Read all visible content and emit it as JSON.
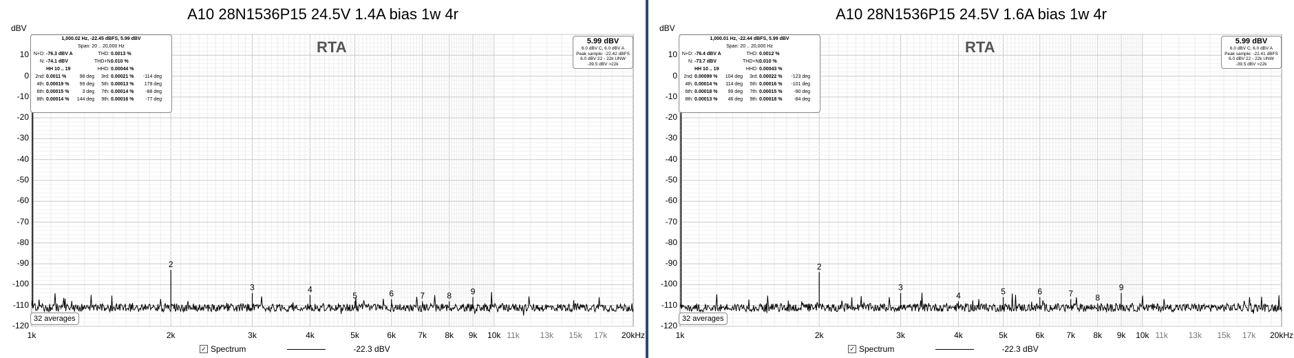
{
  "chart_data": [
    {
      "type": "line",
      "title": "A10 28N1536P15 24.5V 1.4A bias 1w 4r",
      "ylabel": "dBV",
      "xlabel": "",
      "x_scale": "log",
      "xlim": [
        1000,
        20000
      ],
      "ylim": [
        -120,
        20
      ],
      "y_ticks": [
        "10",
        "0",
        "-10",
        "-20",
        "-30",
        "-40",
        "-50",
        "-60",
        "-70",
        "-80",
        "-90",
        "-100",
        "-110",
        "-120"
      ],
      "x_ticks": [
        {
          "v": 1000,
          "label": "1k",
          "dim": false
        },
        {
          "v": 2000,
          "label": "2k",
          "dim": false
        },
        {
          "v": 3000,
          "label": "3k",
          "dim": false
        },
        {
          "v": 4000,
          "label": "4k",
          "dim": false
        },
        {
          "v": 5000,
          "label": "5k",
          "dim": false
        },
        {
          "v": 6000,
          "label": "6k",
          "dim": false
        },
        {
          "v": 7000,
          "label": "7k",
          "dim": false
        },
        {
          "v": 8000,
          "label": "8k",
          "dim": false
        },
        {
          "v": 9000,
          "label": "9k",
          "dim": false
        },
        {
          "v": 10000,
          "label": "10k",
          "dim": false
        },
        {
          "v": 11000,
          "label": "11k",
          "dim": true
        },
        {
          "v": 13000,
          "label": "13k",
          "dim": true
        },
        {
          "v": 15000,
          "label": "15k",
          "dim": true
        },
        {
          "v": 17000,
          "label": "17k",
          "dim": true
        },
        {
          "v": 20000,
          "label": "20kHz",
          "dim": false
        }
      ],
      "watermark": "RTA",
      "averages_label": "32 averages",
      "noise_floor_dbv": -111,
      "fundamental": {
        "x": 1000,
        "y": 6
      },
      "harmonics": [
        {
          "label": "2",
          "x": 2000,
          "y": -93
        },
        {
          "label": "3",
          "x": 3000,
          "y": -104
        },
        {
          "label": "4",
          "x": 4000,
          "y": -105
        },
        {
          "label": "5",
          "x": 5000,
          "y": -108
        },
        {
          "label": "6",
          "x": 6000,
          "y": -107
        },
        {
          "label": "7",
          "x": 7000,
          "y": -108
        },
        {
          "label": "8",
          "x": 8000,
          "y": -108
        },
        {
          "label": "9",
          "x": 9000,
          "y": -106
        }
      ],
      "legend": {
        "spectrum_label": "Spectrum",
        "value_label": "-22.3 dBV"
      },
      "info_box": {
        "header": "1,000.02 Hz, -22.45 dBFS, 5.99 dBV",
        "span": "Span: 20 .. 20,000 Hz",
        "rows": [
          [
            "N+D:",
            "-76.3 dBV A",
            "",
            "THD:",
            "0.0013 %",
            ""
          ],
          [
            "N:",
            "-74.1 dBV",
            "",
            "THD+N:",
            "0.010 %",
            ""
          ],
          [
            "",
            "HH 10 .. 19",
            "",
            "HHD:",
            "0.00044 %",
            ""
          ],
          [
            "2nd:",
            "0.0011 %",
            "98 deg",
            "3rd:",
            "0.00021 %",
            "-114 deg"
          ],
          [
            "4th:",
            "0.00019 %",
            "99 deg",
            "5th:",
            "0.00013 %",
            "179 deg"
          ],
          [
            "6th:",
            "0.00015 %",
            "3 deg",
            "7th:",
            "0.00014 %",
            "-88 deg"
          ],
          [
            "8th:",
            "0.00014 %",
            "144 deg",
            "9th:",
            "0.00016 %",
            "-77 deg"
          ]
        ]
      },
      "level_box": {
        "value": "5.99 dBV",
        "lines": [
          "6.0 dBV C, 6.0 dBV A",
          "Peak sample: -22.42 dBFS",
          "6.0 dBV 22 - 22k UNW",
          "-39.5 dBV >22k"
        ]
      }
    },
    {
      "type": "line",
      "title": "A10 28N1536P15 24.5V 1.6A bias 1w 4r",
      "ylabel": "dBV",
      "xlabel": "",
      "x_scale": "log",
      "xlim": [
        1000,
        20000
      ],
      "ylim": [
        -120,
        20
      ],
      "y_ticks": [
        "10",
        "0",
        "-10",
        "-20",
        "-30",
        "-40",
        "-50",
        "-60",
        "-70",
        "-80",
        "-90",
        "-100",
        "-110",
        "-120"
      ],
      "x_ticks": [
        {
          "v": 1000,
          "label": "1k",
          "dim": false
        },
        {
          "v": 2000,
          "label": "2k",
          "dim": false
        },
        {
          "v": 3000,
          "label": "3k",
          "dim": false
        },
        {
          "v": 4000,
          "label": "4k",
          "dim": false
        },
        {
          "v": 5000,
          "label": "5k",
          "dim": false
        },
        {
          "v": 6000,
          "label": "6k",
          "dim": false
        },
        {
          "v": 7000,
          "label": "7k",
          "dim": false
        },
        {
          "v": 8000,
          "label": "8k",
          "dim": false
        },
        {
          "v": 9000,
          "label": "9k",
          "dim": false
        },
        {
          "v": 10000,
          "label": "10k",
          "dim": false
        },
        {
          "v": 11000,
          "label": "11k",
          "dim": true
        },
        {
          "v": 13000,
          "label": "13k",
          "dim": true
        },
        {
          "v": 15000,
          "label": "15k",
          "dim": true
        },
        {
          "v": 17000,
          "label": "17k",
          "dim": true
        },
        {
          "v": 20000,
          "label": "20kHz",
          "dim": false
        }
      ],
      "watermark": "RTA",
      "averages_label": "32 averages",
      "noise_floor_dbv": -111,
      "fundamental": {
        "x": 1000,
        "y": 6
      },
      "harmonics": [
        {
          "label": "2",
          "x": 2000,
          "y": -94
        },
        {
          "label": "3",
          "x": 3000,
          "y": -104
        },
        {
          "label": "4",
          "x": 4000,
          "y": -108
        },
        {
          "label": "5",
          "x": 5000,
          "y": -106
        },
        {
          "label": "6",
          "x": 6000,
          "y": -106
        },
        {
          "label": "7",
          "x": 7000,
          "y": -107
        },
        {
          "label": "8",
          "x": 8000,
          "y": -109
        },
        {
          "label": "9",
          "x": 9000,
          "y": -104
        }
      ],
      "legend": {
        "spectrum_label": "Spectrum",
        "value_label": "-22.3 dBV"
      },
      "info_box": {
        "header": "1,000.01 Hz, -22.44 dBFS, 5.99 dBV",
        "span": "Span: 20 .. 20,000 Hz",
        "rows": [
          [
            "N+D:",
            "-76.4 dBV A",
            "",
            "THD:",
            "0.0012 %",
            ""
          ],
          [
            "N:",
            "-73.7 dBV",
            "",
            "THD+N:",
            "0.010 %",
            ""
          ],
          [
            "",
            "HH 10 .. 19",
            "",
            "HHD:",
            "0.00043 %",
            ""
          ],
          [
            "2nd:",
            "0.00099 %",
            "104 deg",
            "3rd:",
            "0.00022 %",
            "-123 deg"
          ],
          [
            "4th:",
            "0.00014 %",
            "114 deg",
            "5th:",
            "0.00016 %",
            "-101 deg"
          ],
          [
            "6th:",
            "0.00018 %",
            "99 deg",
            "7th:",
            "0.00015 %",
            "-90 deg"
          ],
          [
            "8th:",
            "0.00013 %",
            "46 deg",
            "9th:",
            "0.00018 %",
            "-84 deg"
          ]
        ]
      },
      "level_box": {
        "value": "5.99 dBV",
        "lines": [
          "6.0 dBV C, 6.0 dBV A",
          "Peak sample: -22.41 dBFS",
          "6.0 dBV 22 - 22k UNW",
          "-39.5 dBV >22k"
        ]
      }
    }
  ]
}
